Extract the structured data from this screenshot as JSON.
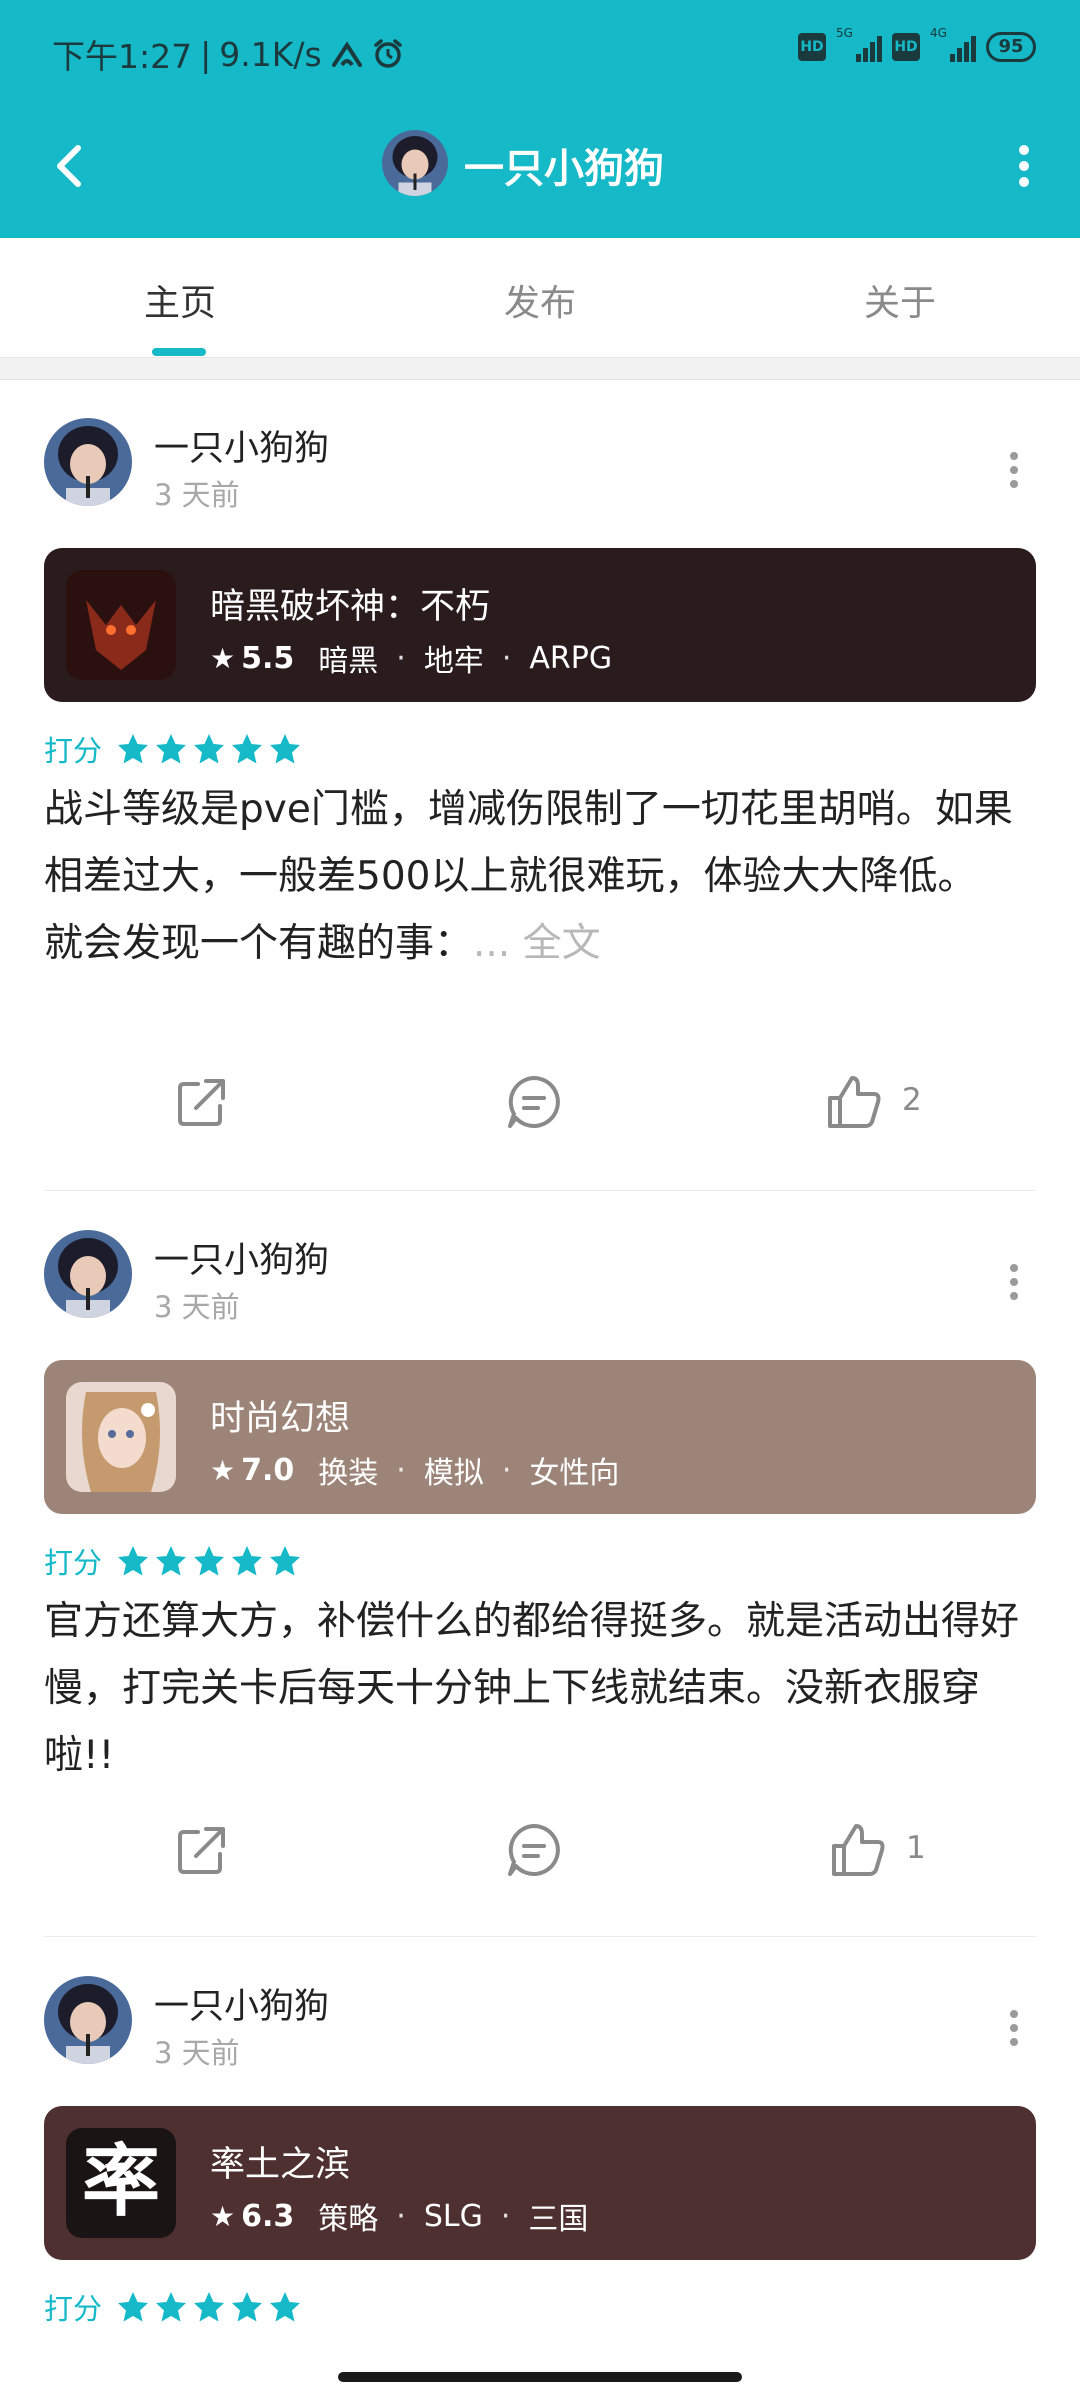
{
  "status_bar": {
    "time": "下午1:27",
    "net_speed": "9.1K/s",
    "sim1_type": "5G",
    "sim2_type": "4G",
    "hd_label": "HD",
    "battery": "95"
  },
  "nav": {
    "title": "一只小狗狗"
  },
  "tabs": [
    {
      "label": "主页",
      "active": true
    },
    {
      "label": "发布",
      "active": false
    },
    {
      "label": "关于",
      "active": false
    }
  ],
  "posts": [
    {
      "author": "一只小狗狗",
      "time": "3 天前",
      "game": {
        "title": "暗黑破坏神：不朽",
        "score": "5.5",
        "tags": [
          "暗黑",
          "地牢",
          "ARPG"
        ],
        "card_color": "#2a1c1c"
      },
      "rating_label": "打分",
      "rating": 5,
      "text": "战斗等级是pve门槛，增减伤限制了一切花里胡哨。如果相差过大，一般差500以上就很难玩，体验大大降低。\n就会发现一个有趣的事：",
      "read_more": "... 全文",
      "likes": "2"
    },
    {
      "author": "一只小狗狗",
      "time": "3 天前",
      "game": {
        "title": "时尚幻想",
        "score": "7.0",
        "tags": [
          "换装",
          "模拟",
          "女性向"
        ],
        "card_color": "#9d8478"
      },
      "rating_label": "打分",
      "rating": 5,
      "text": "官方还算大方，补偿什么的都给得挺多。就是活动出得好慢，打完关卡后每天十分钟上下线就结束。没新衣服穿啦!!",
      "likes": "1"
    },
    {
      "author": "一只小狗狗",
      "time": "3 天前",
      "game": {
        "title": "率土之滨",
        "score": "6.3",
        "tags": [
          "策略",
          "SLG",
          "三国"
        ],
        "card_color": "#4e3030",
        "cover_text": "率"
      },
      "rating_label": "打分",
      "rating": 5
    }
  ],
  "colors": {
    "accent": "#15b9c8"
  }
}
